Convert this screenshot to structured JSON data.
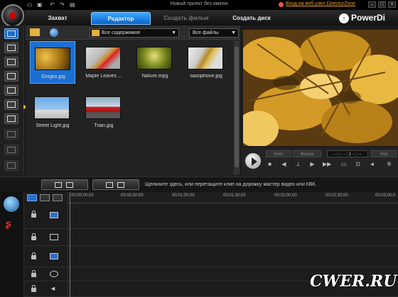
{
  "window": {
    "title": "Новый проект без имени",
    "directorzone_link": "Вход на веб-узел DirectorZone"
  },
  "tabs": [
    {
      "label": "Захват",
      "state": "normal"
    },
    {
      "label": "Редактор",
      "state": "active"
    },
    {
      "label": "Создать фильм",
      "state": "disabled"
    },
    {
      "label": "Создать диск",
      "state": "normal"
    }
  ],
  "brand": "PowerDi",
  "library": {
    "content_filter": "Все содержимое",
    "file_filter": "Все файлы",
    "items": [
      {
        "name": "Gingko.jpg",
        "selected": true,
        "thumb": "gingko"
      },
      {
        "name": "Maple Leaves ...",
        "selected": false,
        "thumb": "maple"
      },
      {
        "name": "Nature.mpg",
        "selected": false,
        "thumb": "nature"
      },
      {
        "name": "saxophone.jpg",
        "selected": false,
        "thumb": "sax"
      },
      {
        "name": "Street Light.jpg",
        "selected": false,
        "thumb": "street"
      },
      {
        "name": "Train.jpg",
        "selected": false,
        "thumb": "train"
      }
    ]
  },
  "preview": {
    "mode_clip": "Клип",
    "mode_film": "Фильм",
    "timecode": "- - ; - - ; 1 - ; - -",
    "quality": "Нор"
  },
  "storyboard": {
    "hint": "Щелкните здесь, или перетащите клип на дорожку мастер видео или КВК."
  },
  "timeline": {
    "ruler": [
      "00;00;00;00",
      "00;00;30;00",
      "00;01;00;00",
      "00;01;30;00",
      "00;02;00;00",
      "00;02;30;00",
      "00;03;00;0"
    ]
  },
  "watermark": "CWER.RU",
  "colors": {
    "accent": "#1b6fd0",
    "tab_active": "#0a64c8",
    "folder": "#e3b23c",
    "link": "#f0a020"
  }
}
